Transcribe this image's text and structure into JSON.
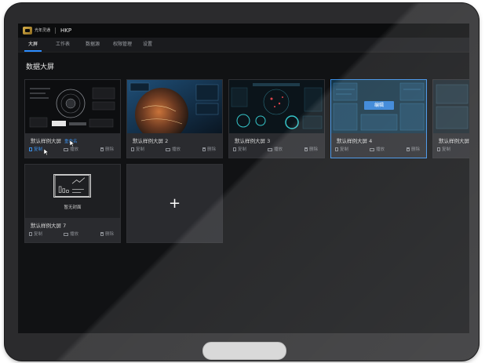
{
  "header": {
    "brand": "光年灵通",
    "app_title": "HKP"
  },
  "nav": {
    "items": [
      {
        "label": "大屏",
        "active": true
      },
      {
        "label": "工作表",
        "active": false
      },
      {
        "label": "数据源",
        "active": false
      },
      {
        "label": "权限管理",
        "active": false
      },
      {
        "label": "设置",
        "active": false
      }
    ]
  },
  "section": {
    "title": "数据大屏"
  },
  "cards": [
    {
      "title": "默认样例大屏",
      "extra_action": "重命名",
      "thumb": "tech-dashboard"
    },
    {
      "title": "默认样例大屏 2",
      "thumb": "earth-dashboard"
    },
    {
      "title": "默认样例大屏 3",
      "thumb": "radar-dashboard"
    },
    {
      "title": "默认样例大屏 4",
      "thumb": "blue-grid-dashboard",
      "selected": true,
      "edit_label": "编辑"
    },
    {
      "title": "默认样例大屏 5",
      "thumb": "partial-dashboard"
    },
    {
      "title": "默认样例大屏 7",
      "thumb": "no-cover",
      "no_cover_label": "暂无封面"
    }
  ],
  "card_actions": {
    "copy": "复制",
    "play": "播放",
    "delete": "删除"
  },
  "add_card": {
    "symbol": "+"
  },
  "colors": {
    "accent": "#2b8cff",
    "screen_bg": "#111214",
    "card_bg": "#2a2b2f"
  }
}
